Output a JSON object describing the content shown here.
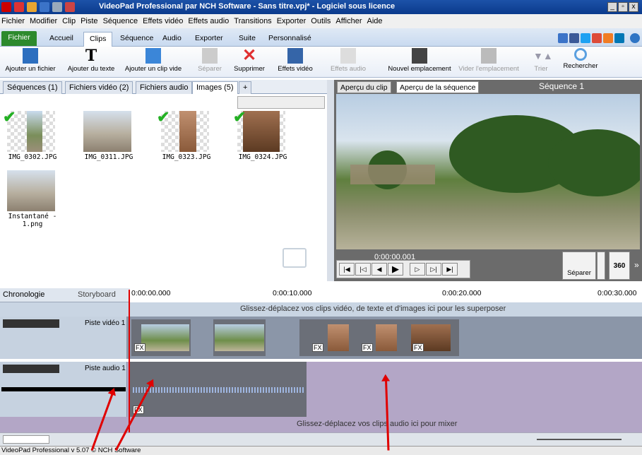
{
  "window": {
    "title": "VideoPad Professional par NCH Software - Sans titre.vpj* - Logiciel sous licence",
    "minimize": "_",
    "restore": "▫",
    "close": "x"
  },
  "menu": [
    "Fichier",
    "Modifier",
    "Clip",
    "Piste",
    "Séquence",
    "Effets vidéo",
    "Effets audio",
    "Transitions",
    "Exporter",
    "Outils",
    "Afficher",
    "Aide"
  ],
  "ribbon_tabs": [
    "Fichier",
    "Accueil",
    "Clips",
    "Séquence",
    "Audio",
    "Exporter",
    "Suite",
    "Personnalisé"
  ],
  "ribbon_active": "Clips",
  "toolbar": {
    "add_file": "Ajouter un fichier",
    "add_text": "Ajouter du texte",
    "add_blank": "Ajouter un clip vide",
    "split": "Séparer",
    "delete": "Supprimer",
    "video_effects": "Effets vidéo",
    "audio_effects": "Effets audio",
    "new_slot": "Nouvel emplacement",
    "empty_slot": "Vider l'emplacement",
    "sort": "Trier",
    "search": "Rechercher"
  },
  "bin_tabs": [
    {
      "label": "Séquences (1)"
    },
    {
      "label": "Fichiers vidéo (2)"
    },
    {
      "label": "Fichiers audio"
    },
    {
      "label": "Images (5)"
    },
    {
      "label": "+"
    }
  ],
  "bin_items": [
    {
      "name": "IMG_0302.JPG"
    },
    {
      "name": "IMG_0311.JPG"
    },
    {
      "name": "IMG_0323.JPG"
    },
    {
      "name": "IMG_0324.JPG"
    },
    {
      "name": "Instantané - 1.png"
    }
  ],
  "preview": {
    "tab_clip": "Aperçu du clip",
    "tab_sequence": "Aperçu de la séquence",
    "sequence_title": "Séquence 1",
    "timecode": "0:00:00.001",
    "split_label": "Séparer",
    "vr_label": "360",
    "more": "»"
  },
  "timeline": {
    "tab_chrono": "Chronologie",
    "tab_storyboard": "Storyboard",
    "ticks": [
      "0:00:00.000",
      "0:00:10.000",
      "0:00:20.000",
      "0:00:30.000"
    ],
    "overlay_hint": "Glissez-déplacez vos clips vidéo, de texte et d'images ici pour les superposer",
    "video_track": "Piste vidéo 1",
    "audio_track": "Piste audio 1",
    "audio_hint": "Glissez-déplacez vos clips audio ici pour mixer",
    "fx": "FX"
  },
  "status": {
    "version": "VideoPad Professional v 5.07 © NCH Software"
  },
  "colors": {
    "title_bar": "#0b3a8c",
    "accent_green": "#2d8a2d",
    "annotation_red": "#e00000"
  }
}
